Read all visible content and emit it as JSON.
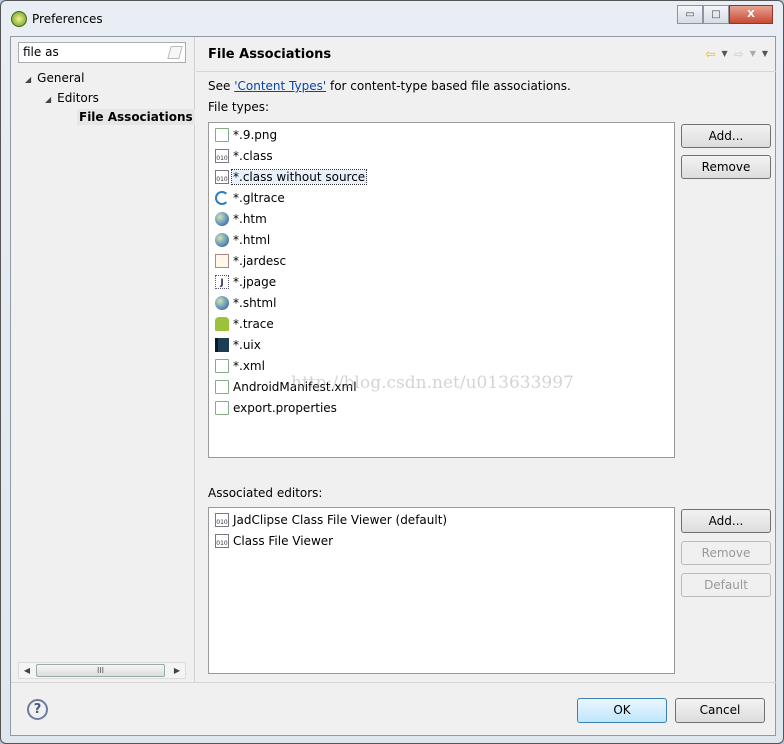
{
  "window": {
    "title": "Preferences",
    "minimize": "▭",
    "maximize": "□",
    "close": "X"
  },
  "sidebar": {
    "filter_value": "file as",
    "tree": [
      {
        "label": "General",
        "expanded": true,
        "level": 0
      },
      {
        "label": "Editors",
        "expanded": true,
        "level": 1
      },
      {
        "label": "File Associations",
        "selected": true,
        "level": 2
      }
    ],
    "scroll_thumb": "III"
  },
  "main": {
    "title": "File Associations",
    "desc_prefix": "See ",
    "desc_link": "'Content Types'",
    "desc_suffix": " for content-type based file associations.",
    "file_types_label": "File types:",
    "file_types": [
      {
        "name": "*.9.png",
        "icon": "file-icon"
      },
      {
        "name": "*.class",
        "icon": "binary-icon"
      },
      {
        "name": "*.class without source",
        "icon": "binary-icon",
        "focused": true
      },
      {
        "name": "*.gltrace",
        "icon": "arc-icon"
      },
      {
        "name": "*.htm",
        "icon": "globe-icon"
      },
      {
        "name": "*.html",
        "icon": "globe-icon"
      },
      {
        "name": "*.jardesc",
        "icon": "jar-icon"
      },
      {
        "name": "*.jpage",
        "icon": "j-icon"
      },
      {
        "name": "*.shtml",
        "icon": "globe-icon"
      },
      {
        "name": "*.trace",
        "icon": "android-icon"
      },
      {
        "name": "*.uix",
        "icon": "uix-icon"
      },
      {
        "name": "*.xml",
        "icon": "file-icon"
      },
      {
        "name": "AndroidManifest.xml",
        "icon": "file-icon"
      },
      {
        "name": "export.properties",
        "icon": "file-icon"
      }
    ],
    "file_buttons": {
      "add": "Add...",
      "remove": "Remove"
    },
    "editors_label": "Associated editors:",
    "editors": [
      {
        "name": "JadClipse Class File Viewer (default)",
        "icon": "binary-icon"
      },
      {
        "name": "Class File Viewer",
        "icon": "binary-icon"
      }
    ],
    "editor_buttons": {
      "add": "Add...",
      "remove": "Remove",
      "default": "Default"
    },
    "watermark": "http://blog.csdn.net/u013633997"
  },
  "footer": {
    "help": "?",
    "ok": "OK",
    "cancel": "Cancel"
  },
  "colors": {
    "link": "#0645ad",
    "default_button": "#3c7fb1"
  }
}
